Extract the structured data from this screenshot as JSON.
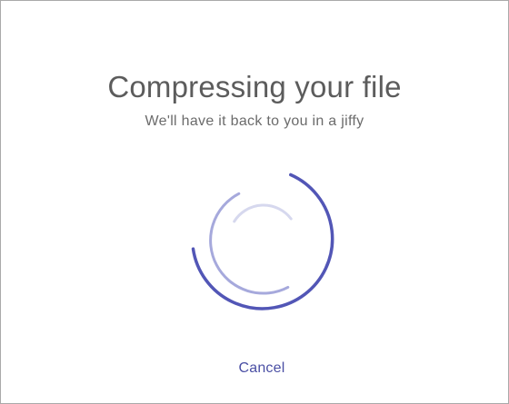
{
  "dialog": {
    "title": "Compressing your file",
    "subtitle": "We'll have it back to you in a jiffy",
    "spinner_icon": "loading-spinner-icon",
    "cancel_label": "Cancel"
  },
  "colors": {
    "title": "#5c5c5c",
    "subtitle": "#6b6b6b",
    "accent": "#5256b6",
    "accent_mid": "#a6a9dc",
    "accent_light": "#d6d8ee",
    "border": "#a9a9a9",
    "background": "#ffffff"
  }
}
